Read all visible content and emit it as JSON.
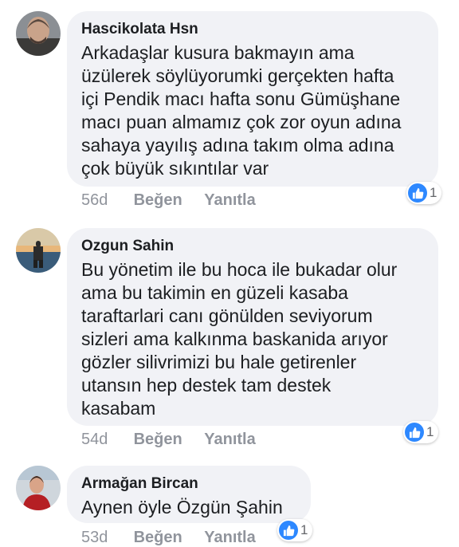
{
  "comments": [
    {
      "author": "Hascikolata Hsn",
      "lines": [
        "Arkadaşlar kusura bakmayın ama",
        "üzülerek söylüyorumki gerçekten hafta",
        "içi Pendik macı hafta sonu Gümüşhane",
        "macı puan almamız çok zor oyun adına",
        "sahaya yayılış adına takım olma adına",
        "çok büyük sıkıntılar var"
      ],
      "time": "56d",
      "like_label": "Beğen",
      "reply_label": "Yanıtla",
      "reaction_count": "1"
    },
    {
      "author": "Ozgun Sahin",
      "lines": [
        "Bu yönetim ile bu hoca ile bukadar olur",
        "ama bu takimin en güzeli kasaba",
        "taraftarlari canı gönülden seviyorum",
        "sizleri ama kalkınma baskanida arıyor",
        "gözler silivrimizi bu hale getirenler",
        "utansın hep destek tam destek",
        "kasabam"
      ],
      "time": "54d",
      "like_label": "Beğen",
      "reply_label": "Yanıtla",
      "reaction_count": "1"
    },
    {
      "author": "Armağan Bircan",
      "lines": [
        "Aynen öyle Özgün Şahin"
      ],
      "time": "53d",
      "like_label": "Beğen",
      "reply_label": "Yanıtla",
      "reaction_count": "1"
    }
  ],
  "icons": {
    "reaction": "like-thumbs-up-icon",
    "reaction_color": "#2d88ff"
  },
  "colors": {
    "bubble": "#f1f2f6",
    "text": "#1c1e21",
    "meta": "#90949c"
  }
}
